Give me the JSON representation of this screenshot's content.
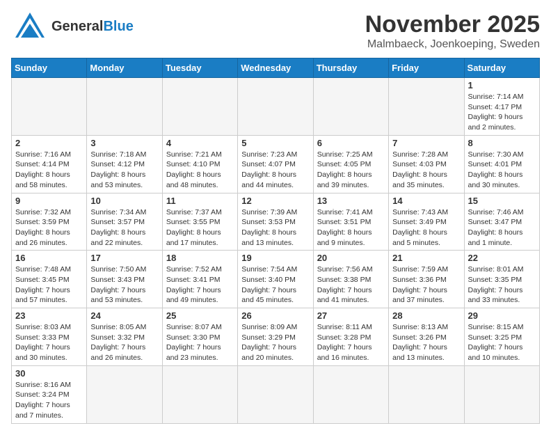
{
  "header": {
    "logo_general": "General",
    "logo_blue": "Blue",
    "title": "November 2025",
    "subtitle": "Malmbaeck, Joenkoeping, Sweden"
  },
  "weekdays": [
    "Sunday",
    "Monday",
    "Tuesday",
    "Wednesday",
    "Thursday",
    "Friday",
    "Saturday"
  ],
  "weeks": [
    [
      {
        "day": "",
        "info": ""
      },
      {
        "day": "",
        "info": ""
      },
      {
        "day": "",
        "info": ""
      },
      {
        "day": "",
        "info": ""
      },
      {
        "day": "",
        "info": ""
      },
      {
        "day": "",
        "info": ""
      },
      {
        "day": "1",
        "info": "Sunrise: 7:14 AM\nSunset: 4:17 PM\nDaylight: 9 hours\nand 2 minutes."
      }
    ],
    [
      {
        "day": "2",
        "info": "Sunrise: 7:16 AM\nSunset: 4:14 PM\nDaylight: 8 hours\nand 58 minutes."
      },
      {
        "day": "3",
        "info": "Sunrise: 7:18 AM\nSunset: 4:12 PM\nDaylight: 8 hours\nand 53 minutes."
      },
      {
        "day": "4",
        "info": "Sunrise: 7:21 AM\nSunset: 4:10 PM\nDaylight: 8 hours\nand 48 minutes."
      },
      {
        "day": "5",
        "info": "Sunrise: 7:23 AM\nSunset: 4:07 PM\nDaylight: 8 hours\nand 44 minutes."
      },
      {
        "day": "6",
        "info": "Sunrise: 7:25 AM\nSunset: 4:05 PM\nDaylight: 8 hours\nand 39 minutes."
      },
      {
        "day": "7",
        "info": "Sunrise: 7:28 AM\nSunset: 4:03 PM\nDaylight: 8 hours\nand 35 minutes."
      },
      {
        "day": "8",
        "info": "Sunrise: 7:30 AM\nSunset: 4:01 PM\nDaylight: 8 hours\nand 30 minutes."
      }
    ],
    [
      {
        "day": "9",
        "info": "Sunrise: 7:32 AM\nSunset: 3:59 PM\nDaylight: 8 hours\nand 26 minutes."
      },
      {
        "day": "10",
        "info": "Sunrise: 7:34 AM\nSunset: 3:57 PM\nDaylight: 8 hours\nand 22 minutes."
      },
      {
        "day": "11",
        "info": "Sunrise: 7:37 AM\nSunset: 3:55 PM\nDaylight: 8 hours\nand 17 minutes."
      },
      {
        "day": "12",
        "info": "Sunrise: 7:39 AM\nSunset: 3:53 PM\nDaylight: 8 hours\nand 13 minutes."
      },
      {
        "day": "13",
        "info": "Sunrise: 7:41 AM\nSunset: 3:51 PM\nDaylight: 8 hours\nand 9 minutes."
      },
      {
        "day": "14",
        "info": "Sunrise: 7:43 AM\nSunset: 3:49 PM\nDaylight: 8 hours\nand 5 minutes."
      },
      {
        "day": "15",
        "info": "Sunrise: 7:46 AM\nSunset: 3:47 PM\nDaylight: 8 hours\nand 1 minute."
      }
    ],
    [
      {
        "day": "16",
        "info": "Sunrise: 7:48 AM\nSunset: 3:45 PM\nDaylight: 7 hours\nand 57 minutes."
      },
      {
        "day": "17",
        "info": "Sunrise: 7:50 AM\nSunset: 3:43 PM\nDaylight: 7 hours\nand 53 minutes."
      },
      {
        "day": "18",
        "info": "Sunrise: 7:52 AM\nSunset: 3:41 PM\nDaylight: 7 hours\nand 49 minutes."
      },
      {
        "day": "19",
        "info": "Sunrise: 7:54 AM\nSunset: 3:40 PM\nDaylight: 7 hours\nand 45 minutes."
      },
      {
        "day": "20",
        "info": "Sunrise: 7:56 AM\nSunset: 3:38 PM\nDaylight: 7 hours\nand 41 minutes."
      },
      {
        "day": "21",
        "info": "Sunrise: 7:59 AM\nSunset: 3:36 PM\nDaylight: 7 hours\nand 37 minutes."
      },
      {
        "day": "22",
        "info": "Sunrise: 8:01 AM\nSunset: 3:35 PM\nDaylight: 7 hours\nand 33 minutes."
      }
    ],
    [
      {
        "day": "23",
        "info": "Sunrise: 8:03 AM\nSunset: 3:33 PM\nDaylight: 7 hours\nand 30 minutes."
      },
      {
        "day": "24",
        "info": "Sunrise: 8:05 AM\nSunset: 3:32 PM\nDaylight: 7 hours\nand 26 minutes."
      },
      {
        "day": "25",
        "info": "Sunrise: 8:07 AM\nSunset: 3:30 PM\nDaylight: 7 hours\nand 23 minutes."
      },
      {
        "day": "26",
        "info": "Sunrise: 8:09 AM\nSunset: 3:29 PM\nDaylight: 7 hours\nand 20 minutes."
      },
      {
        "day": "27",
        "info": "Sunrise: 8:11 AM\nSunset: 3:28 PM\nDaylight: 7 hours\nand 16 minutes."
      },
      {
        "day": "28",
        "info": "Sunrise: 8:13 AM\nSunset: 3:26 PM\nDaylight: 7 hours\nand 13 minutes."
      },
      {
        "day": "29",
        "info": "Sunrise: 8:15 AM\nSunset: 3:25 PM\nDaylight: 7 hours\nand 10 minutes."
      }
    ],
    [
      {
        "day": "30",
        "info": "Sunrise: 8:16 AM\nSunset: 3:24 PM\nDaylight: 7 hours\nand 7 minutes."
      },
      {
        "day": "",
        "info": ""
      },
      {
        "day": "",
        "info": ""
      },
      {
        "day": "",
        "info": ""
      },
      {
        "day": "",
        "info": ""
      },
      {
        "day": "",
        "info": ""
      },
      {
        "day": "",
        "info": ""
      }
    ]
  ]
}
